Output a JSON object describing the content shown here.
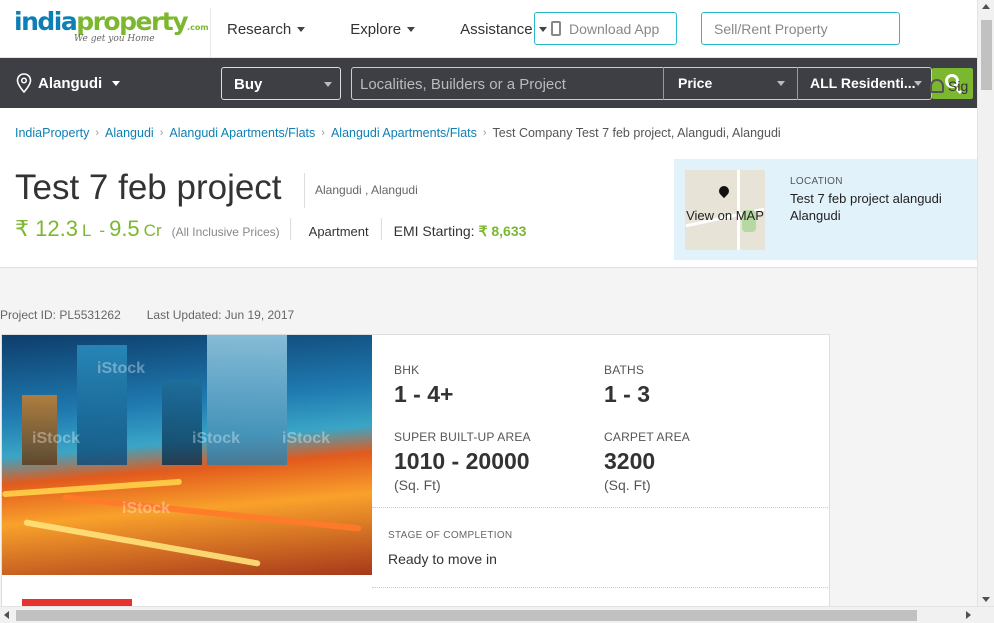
{
  "brand": {
    "part1": "india",
    "part2": "property",
    "suffix": ".com",
    "tagline": "We get you Home"
  },
  "nav": {
    "items": [
      "Research",
      "Explore",
      "Assistance"
    ]
  },
  "search": {
    "city": "Alangudi",
    "mode": "Buy",
    "placeholder": "Localities, Builders or a Project",
    "download_app": "Download App",
    "price": "Price",
    "sell_rent": "Sell/Rent Property",
    "property_type": "ALL Residenti...",
    "signin": "Sig"
  },
  "breadcrumb": [
    {
      "label": "IndiaProperty",
      "link": true
    },
    {
      "label": "Alangudi",
      "link": true
    },
    {
      "label": "Alangudi Apartments/Flats",
      "link": true
    },
    {
      "label": "Alangudi Apartments/Flats",
      "link": true
    },
    {
      "label": "Test Company Test 7 feb project, Alangudi, Alangudi",
      "link": false
    }
  ],
  "project": {
    "title": "Test 7 feb project",
    "location": "Alangudi , Alangudi",
    "price_from": "₹ 12.3",
    "price_from_unit": "L",
    "price_to": "9.5",
    "price_to_unit": "Cr",
    "price_dash": "-",
    "price_note": "(All Inclusive Prices)",
    "type": "Apartment",
    "emi_label": "EMI Starting:",
    "emi_value": "₹ 8,633",
    "id_label": "Project ID: PL5531262",
    "updated_label": "Last Updated: Jun 19, 2017"
  },
  "location_box": {
    "label": "LOCATION",
    "value": "Test 7 feb project alangudi Alangudi",
    "map_text": "View on MAP"
  },
  "details": {
    "bhk_label": "BHK",
    "bhk_value": "1 - 4+",
    "baths_label": "BATHS",
    "baths_value": "1 - 3",
    "sba_label": "SUPER BUILT-UP AREA",
    "sba_value": "1010 - 20000",
    "sba_unit": "(Sq. Ft)",
    "carpet_label": "CARPET AREA",
    "carpet_value": "3200",
    "carpet_unit": "(Sq. Ft)",
    "stage_label": "STAGE OF COMPLETION",
    "stage_value": "Ready to move in"
  },
  "photo": {
    "watermark": "iStock"
  },
  "colors": {
    "brand_blue": "#0e7fb4",
    "brand_green": "#7cb82f",
    "searchbar": "#3d3f44",
    "highlight": "#2bb8c8"
  }
}
